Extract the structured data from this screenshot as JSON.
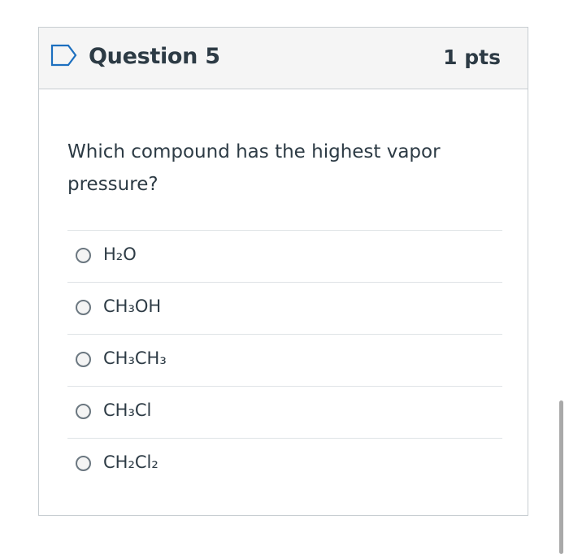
{
  "question": {
    "title": "Question 5",
    "points": "1 pts",
    "text": "Which compound has the highest vapor pressure?",
    "answers": [
      {
        "label": "H₂O",
        "selected": false
      },
      {
        "label": "CH₃OH",
        "selected": false
      },
      {
        "label": "CH₃CH₃",
        "selected": false
      },
      {
        "label": "CH₃Cl",
        "selected": false
      },
      {
        "label": "CH₂Cl₂",
        "selected": false
      }
    ]
  },
  "icons": {
    "flag": "bookmark-flag-icon"
  },
  "colors": {
    "text": "#2d3b45",
    "border": "#c7cdd1",
    "header_bg": "#f5f5f5",
    "flag_stroke": "#1c6fbf"
  }
}
